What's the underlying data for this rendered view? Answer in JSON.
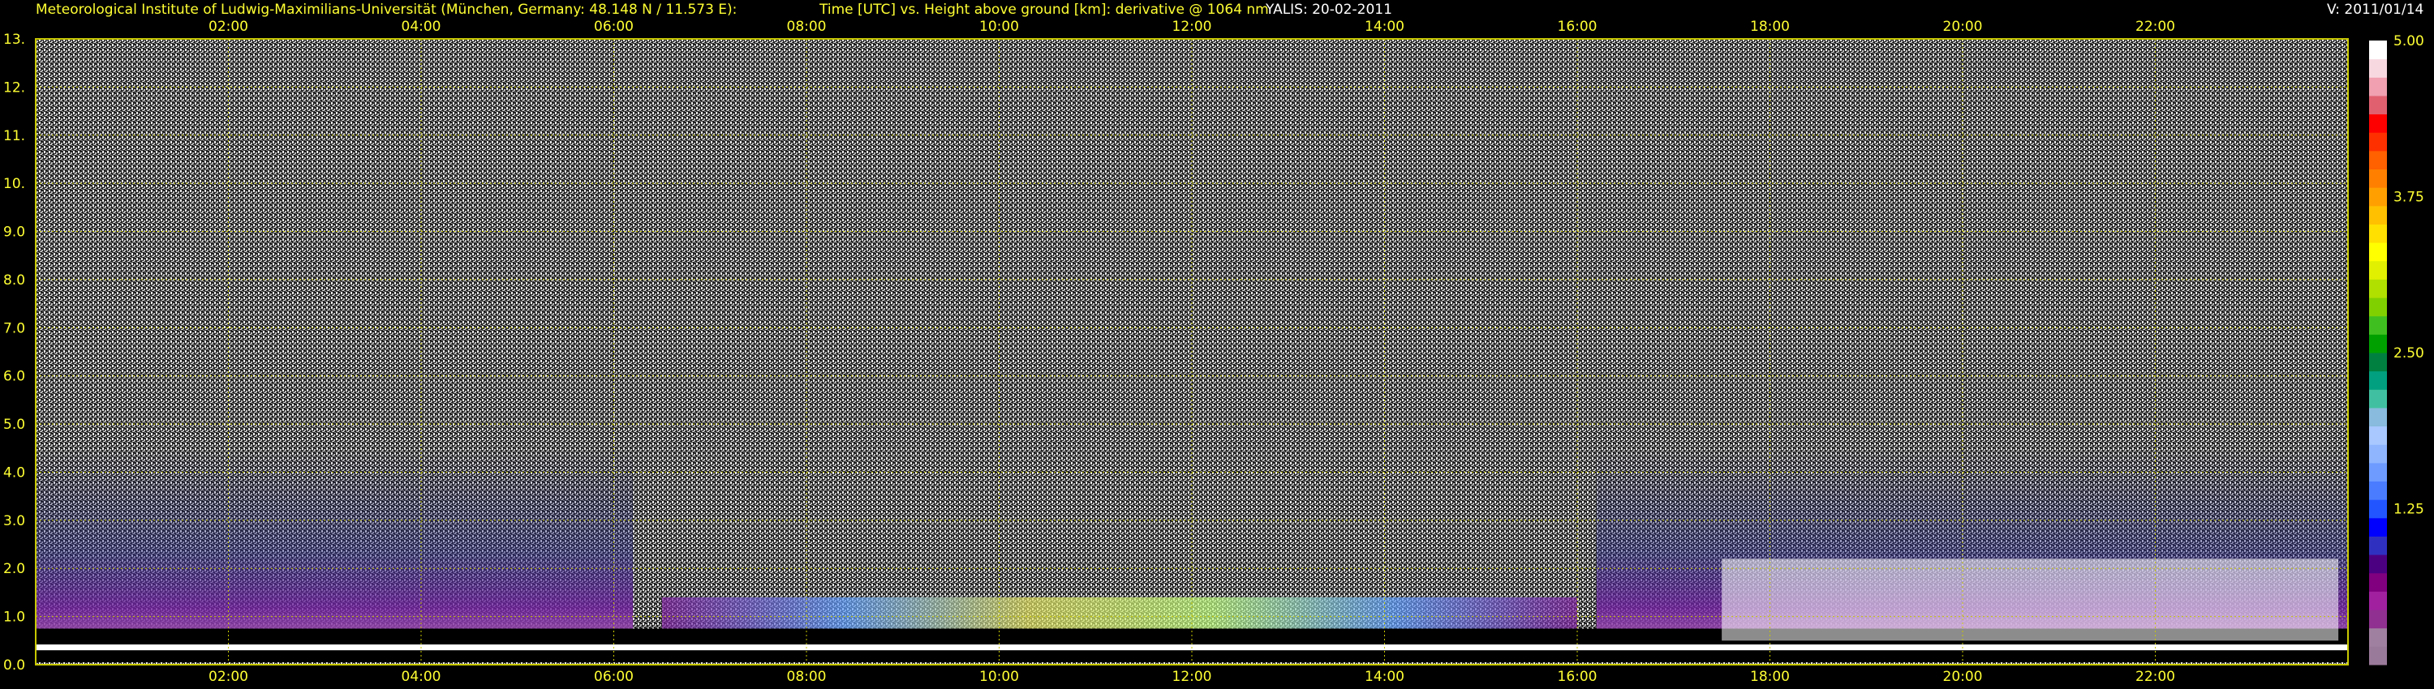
{
  "header": {
    "institute": "Meteorological Institute of Ludwig-Maximilians-Universität (München, Germany: 48.148 N / 11.573 E):",
    "title": "Time [UTC] vs. Height above ground [km]: derivative @ 1064 nm",
    "instrument": "YALIS: 20-02-2011",
    "version": "V: 2011/01/14"
  },
  "colors": {
    "text": "#ffff33",
    "grid": "#c8c800",
    "background": "#000000"
  },
  "chart_data": {
    "type": "heatmap",
    "title": "Time [UTC] vs. Height above ground [km]: derivative @ 1064 nm",
    "xlabel": "Time [UTC]",
    "ylabel": "Height above ground [km]",
    "x_ticks": [
      "02:00",
      "04:00",
      "06:00",
      "08:00",
      "10:00",
      "12:00",
      "14:00",
      "16:00",
      "18:00",
      "20:00",
      "22:00"
    ],
    "x_tick_hours": [
      2,
      4,
      6,
      8,
      10,
      12,
      14,
      16,
      18,
      20,
      22
    ],
    "xlim_hours": [
      0,
      24
    ],
    "y_ticks": [
      "0.0",
      "1.0",
      "2.0",
      "3.0",
      "4.0",
      "5.0",
      "6.0",
      "7.0",
      "8.0",
      "9.0",
      "10.",
      "11.",
      "12.",
      "13."
    ],
    "y_tick_values": [
      0,
      1,
      2,
      3,
      4,
      5,
      6,
      7,
      8,
      9,
      10,
      11,
      12,
      13
    ],
    "ylim_km": [
      0,
      13
    ],
    "grid": true,
    "colorbar": {
      "labels": [
        "5.00",
        "3.75",
        "2.50",
        "1.25"
      ],
      "values": [
        5.0,
        3.75,
        2.5,
        1.25
      ],
      "range": [
        0,
        5.0
      ],
      "colors": [
        "#9a7a9a",
        "#a080a0",
        "#903090",
        "#a020a0",
        "#800080",
        "#4b0082",
        "#3030c0",
        "#0000ff",
        "#2255ff",
        "#4a7cff",
        "#6d9bff",
        "#8fb5ff",
        "#a8c8ff",
        "#88bbdd",
        "#40c0a0",
        "#00a080",
        "#008040",
        "#00a000",
        "#40c020",
        "#80d000",
        "#b0e000",
        "#e0f000",
        "#ffff00",
        "#ffe000",
        "#ffc000",
        "#ffa000",
        "#ff8000",
        "#ff6000",
        "#ff3000",
        "#ff0000",
        "#e06070",
        "#f0a0b0",
        "#f8d8e0",
        "#ffffff"
      ]
    }
  }
}
